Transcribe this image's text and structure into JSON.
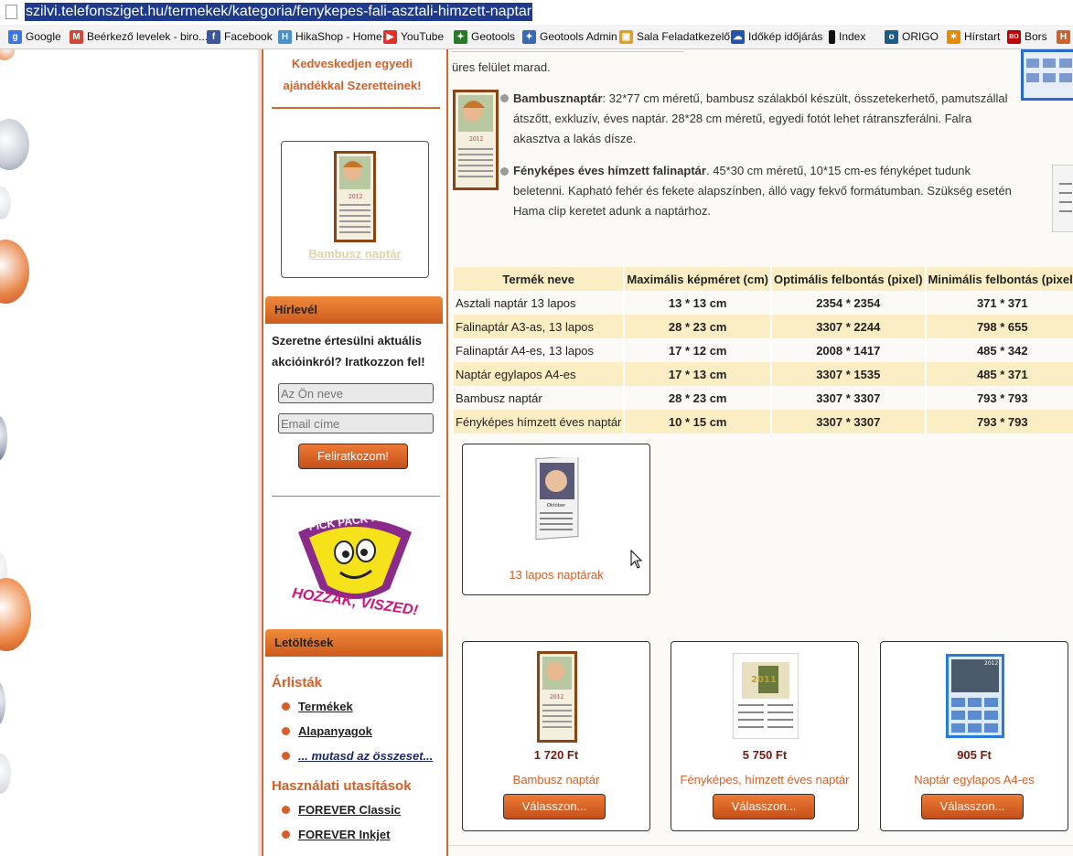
{
  "browser": {
    "url": "szilvi.telefonsziget.hu/termekek/kategoria/fenykepes-fali-asztali-himzett-naptar",
    "bookmarks": [
      {
        "label": "Google",
        "icon": "google-icon",
        "color": "#3b78e7"
      },
      {
        "label": "Beérkező levelek - biro...",
        "icon": "gmail-icon",
        "color": "#d44638"
      },
      {
        "label": "Facebook",
        "icon": "facebook-icon",
        "color": "#3b5998"
      },
      {
        "label": "HikaShop - Home",
        "icon": "hikashop-icon",
        "color": "#4a90c8"
      },
      {
        "label": "YouTube",
        "icon": "youtube-icon",
        "color": "#e52d27"
      },
      {
        "label": "Geotools",
        "icon": "geotools-icon",
        "color": "#2a7a2a"
      },
      {
        "label": "Geotools Admin",
        "icon": "geotools-admin-icon",
        "color": "#3a6ab0"
      },
      {
        "label": "Sala Feladatkezelő",
        "icon": "sala-icon",
        "color": "#e0a020"
      },
      {
        "label": "Időkép időjárás",
        "icon": "idokep-icon",
        "color": "#2255aa"
      },
      {
        "label": "Index",
        "icon": "index-icon",
        "color": "#111111"
      },
      {
        "label": "ORIGO",
        "icon": "origo-icon",
        "color": "#1a5c8a"
      },
      {
        "label": "Hírstart",
        "icon": "hirstart-icon",
        "color": "#e88a00"
      },
      {
        "label": "Bors",
        "icon": "bors-icon",
        "color": "#c00000"
      },
      {
        "label": "H",
        "icon": "h-icon",
        "color": "#d2602a"
      }
    ]
  },
  "sidebar": {
    "promo": "Kedveskedjen egyedi ajándékkal Szeretteinek!",
    "featured_label": "Bambusz naptár",
    "newsletter": {
      "title": "Hírlevél",
      "text": "Szeretne értesülni aktuális akcióinkról? Iratkozzon fel!",
      "name_placeholder": "Az Ön neve",
      "email_placeholder": "Email címe",
      "button": "Feliratkozom!"
    },
    "logo": {
      "top_text": "PICK PACK PONT",
      "bottom_text": "HOZZÁK, VISZED!"
    },
    "downloads": {
      "title": "Letöltések",
      "pricelists_title": "Árlisták",
      "pricelists": [
        "Termékek",
        "Alapanyagok",
        "... mutasd az összeset..."
      ],
      "manuals_title": "Használati utasítások",
      "manuals": [
        "FOREVER Classic",
        "FOREVER Inkjet"
      ]
    }
  },
  "main": {
    "intro": "üres felület marad.",
    "products_desc": [
      {
        "title": "Bambusznaptár",
        "text": ": 32*77 cm méretű, bambusz szálakból készült, összetekerhető, pamutszállal átszőtt, exkluzív, éves naptár. 28*28 cm méretű, egyedi fotót lehet rátranszferálni. Falra akasztva a lakás dísze."
      },
      {
        "title": "Fényképes éves hímzett falinaptár",
        "text": ". 45*30 cm méretű, 10*15 cm-es fényképet tudunk beletenni. Kapható fehér és fekete alapszínben, álló vagy fekvő formátumban. Szükség esetén Hama clip keretet adunk a naptárhoz."
      }
    ],
    "table": {
      "headers": [
        "Termék neve",
        "Maximális képméret (cm)",
        "Optimális felbontás (pixel)",
        "Minimális felbontás (pixel)"
      ],
      "rows": [
        [
          "Asztali naptár 13 lapos",
          "13 * 13 cm",
          "2354 * 2354",
          "371 * 371"
        ],
        [
          "Falinaptár A3-as, 13 lapos",
          "28 * 23 cm",
          "3307 * 2244",
          "798 * 655"
        ],
        [
          "Falinaptár A4-es, 13 lapos",
          "17 * 12 cm",
          "2008 * 1417",
          "485 * 342"
        ],
        [
          "Naptár egylapos A4-es",
          "17 * 13 cm",
          "3307 * 1535",
          "485 * 371"
        ],
        [
          "Bambusz naptár",
          "28 * 23 cm",
          "3307 * 3307",
          "793 * 793"
        ],
        [
          "Fényképes hímzett éves naptár",
          "10 * 15 cm",
          "3307 * 3307",
          "793 * 793"
        ]
      ]
    },
    "category": {
      "label": "13 lapos naptárak",
      "img_text": "Október"
    },
    "products": [
      {
        "price": "1 720 Ft",
        "name": "Bambusz naptár",
        "button": "Válasszon...",
        "year": "2012"
      },
      {
        "price": "5 750 Ft",
        "name": "Fényképes, hímzett éves naptár",
        "button": "Válasszon...",
        "year": "2011"
      },
      {
        "price": "905 Ft",
        "name": "Naptár egylapos A4-es",
        "button": "Válasszon...",
        "year": "2012"
      }
    ]
  },
  "colors": {
    "accent": "#d2602a",
    "table_band": "#fbedc4",
    "url_highlight": "#1d3a8c"
  }
}
